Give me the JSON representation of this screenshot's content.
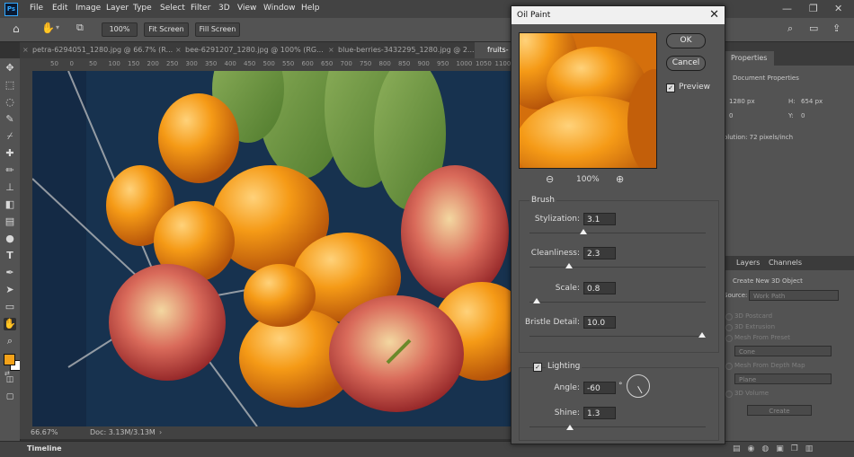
{
  "menu": {
    "logo": "Ps",
    "items": [
      "File",
      "Edit",
      "Image",
      "Layer",
      "Type",
      "Select",
      "Filter",
      "3D",
      "View",
      "Window",
      "Help"
    ]
  },
  "options": {
    "zoom_btn": "100%",
    "fit_screen": "Fit Screen",
    "fill_screen": "Fill Screen"
  },
  "tabs": [
    "petra-6294051_1280.jpg @ 66.7% (R...",
    "bee-6291207_1280.jpg @ 100% (RG...",
    "blue-berries-3432295_1280.jpg @ 2...",
    "fruits-"
  ],
  "ruler": [
    "50",
    "0",
    "50",
    "100",
    "150",
    "200",
    "250",
    "300",
    "350",
    "400",
    "450",
    "500",
    "550",
    "600",
    "650",
    "700",
    "750",
    "800",
    "850",
    "900",
    "950",
    "1000",
    "1050",
    "1100"
  ],
  "status": {
    "zoom": "66.67%",
    "doc": "Doc: 3.13M/3.13M"
  },
  "timeline": "Timeline",
  "dialog": {
    "title": "Oil Paint",
    "ok": "OK",
    "cancel": "Cancel",
    "preview_label": "Preview",
    "preview_zoom": "100%",
    "brush_title": "Brush",
    "brush": [
      {
        "label": "Stylization:",
        "value": "3.1",
        "frac": 0.31
      },
      {
        "label": "Cleanliness:",
        "value": "2.3",
        "frac": 0.23
      },
      {
        "label": "Scale:",
        "value": "0.8",
        "frac": 0.04
      },
      {
        "label": "Bristle Detail:",
        "value": "10.0",
        "frac": 1.0
      }
    ],
    "lighting_title": "Lighting",
    "angle_label": "Angle:",
    "angle_value": "-60",
    "angle_unit": "°",
    "shine_label": "Shine:",
    "shine_value": "1.3",
    "shine_frac": 0.13
  },
  "panel": {
    "properties_tab": "Properties",
    "doc_props": "Document Properties",
    "w": "1280 px",
    "h_label": "H:",
    "h": "654 px",
    "x": "0",
    "y_label": "Y:",
    "y": "0",
    "resolution": "olution: 72 pixels/inch",
    "layers_tab": "Layers",
    "channels_tab": "Channels",
    "create_3d": "Create New 3D Object",
    "source_label": "Source:",
    "source_value": "Work Path",
    "opts": [
      "3D Postcard",
      "3D Extrusion",
      "Mesh From Preset",
      "Cone",
      "Mesh From Depth Map",
      "Plane",
      "3D Volume"
    ],
    "create_btn": "Create"
  },
  "colors": {
    "foreground": "#f4a21a",
    "background": "#ffffff",
    "accent": "#31a8ff"
  }
}
